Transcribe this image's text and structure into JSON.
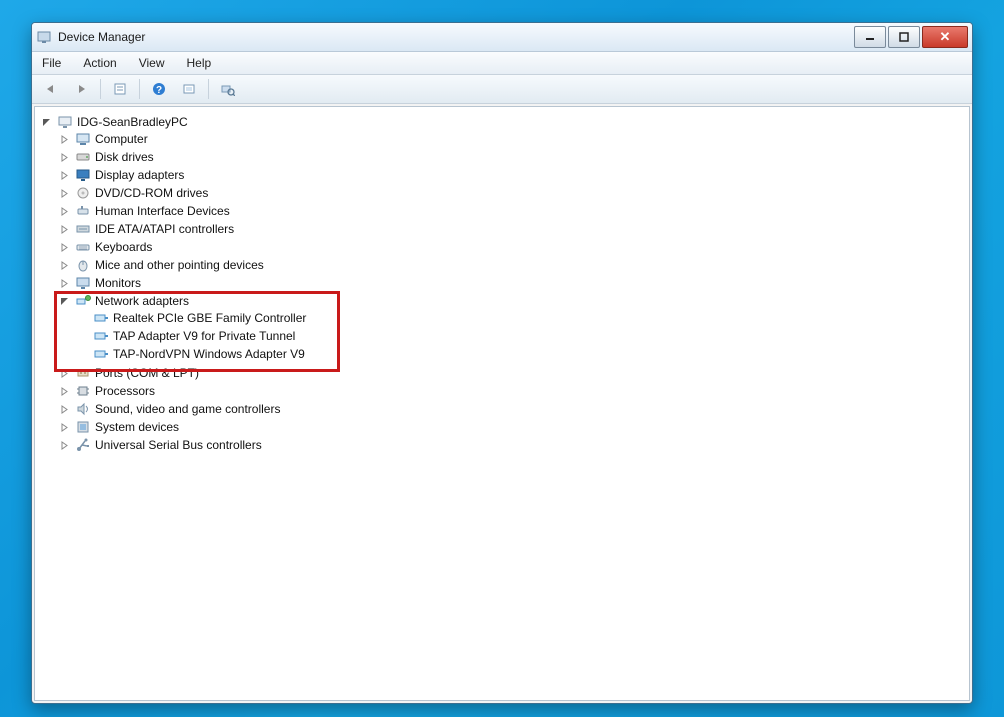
{
  "window": {
    "title": "Device Manager"
  },
  "menubar": {
    "file": "File",
    "action": "Action",
    "view": "View",
    "help": "Help"
  },
  "tree": {
    "root": "IDG-SeanBradleyPC",
    "categories": [
      {
        "label": "Computer",
        "expanded": false
      },
      {
        "label": "Disk drives",
        "expanded": false
      },
      {
        "label": "Display adapters",
        "expanded": false
      },
      {
        "label": "DVD/CD-ROM drives",
        "expanded": false
      },
      {
        "label": "Human Interface Devices",
        "expanded": false
      },
      {
        "label": "IDE ATA/ATAPI controllers",
        "expanded": false
      },
      {
        "label": "Keyboards",
        "expanded": false
      },
      {
        "label": "Mice and other pointing devices",
        "expanded": false
      },
      {
        "label": "Monitors",
        "expanded": false
      },
      {
        "label": "Network adapters",
        "expanded": true,
        "children": [
          "Realtek PCIe GBE Family Controller",
          "TAP Adapter V9 for Private Tunnel",
          "TAP-NordVPN Windows Adapter V9"
        ]
      },
      {
        "label": "Ports (COM & LPT)",
        "expanded": false
      },
      {
        "label": "Processors",
        "expanded": false
      },
      {
        "label": "Sound, video and game controllers",
        "expanded": false
      },
      {
        "label": "System devices",
        "expanded": false
      },
      {
        "label": "Universal Serial Bus controllers",
        "expanded": false
      }
    ]
  }
}
